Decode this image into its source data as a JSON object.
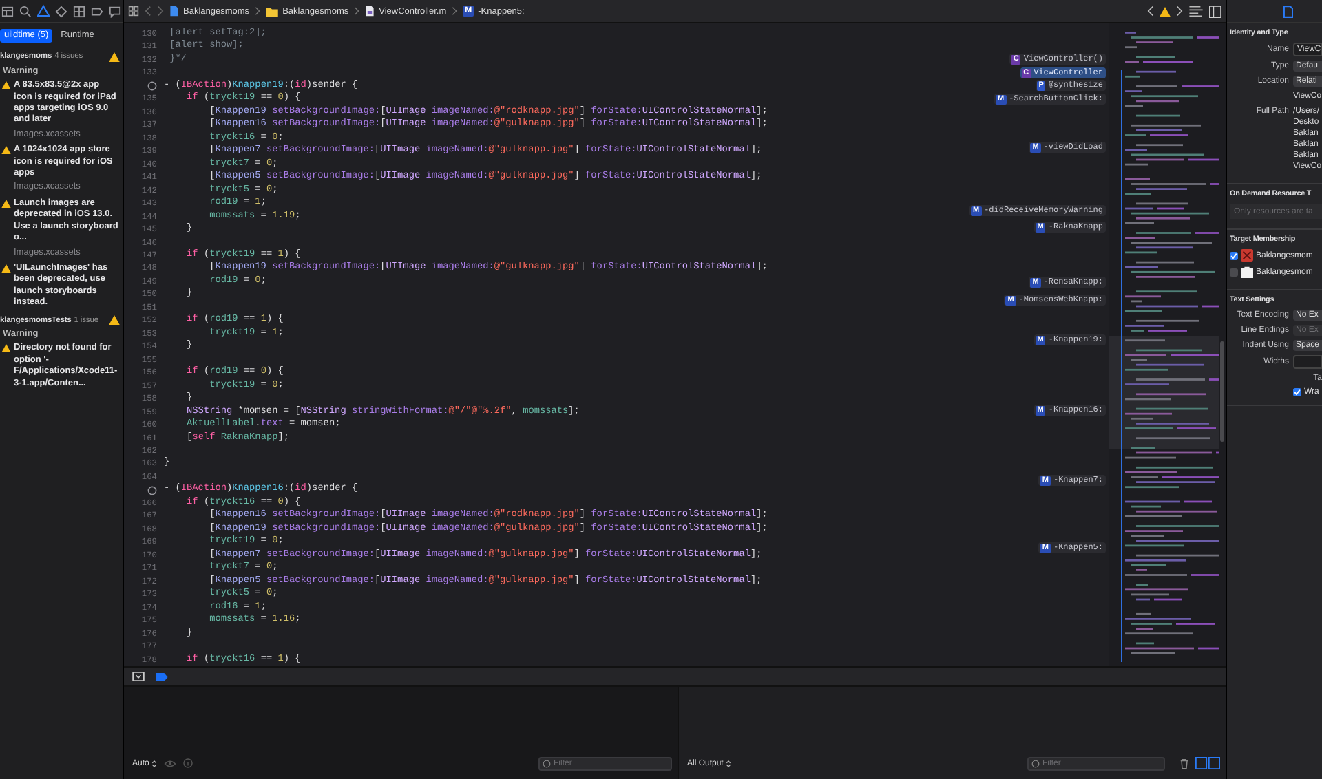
{
  "navigator": {
    "icons": [
      {
        "kind": "hierarchy",
        "selected": false
      },
      {
        "kind": "search",
        "selected": false
      },
      {
        "kind": "warning",
        "selected": true
      },
      {
        "kind": "diamond",
        "selected": false
      },
      {
        "kind": "grid",
        "selected": false
      },
      {
        "kind": "tag",
        "selected": false
      },
      {
        "kind": "bubble",
        "selected": false
      }
    ],
    "scopes": [
      {
        "label": "uildtime (5)",
        "selected": true
      },
      {
        "label": "Runtime",
        "selected": false
      }
    ],
    "groups": [
      {
        "name": "klangesmoms",
        "count": "4 issues",
        "section": "Warning",
        "issues": [
          {
            "message": "A 83.5x83.5@2x app icon is required for iPad apps targeting iOS 9.0 and later",
            "source": "Images.xcassets"
          },
          {
            "message": "A 1024x1024 app store icon is required for iOS apps",
            "source": "Images.xcassets"
          },
          {
            "message": "Launch images are deprecated in iOS 13.0. Use a launch storyboard o...",
            "source": "Images.xcassets"
          },
          {
            "message": "'UILaunchImages' has been deprecated, use launch storyboards instead."
          }
        ]
      },
      {
        "name": "klangesmomsTests",
        "count": "1 issue",
        "section": "Warning",
        "issues": [
          {
            "message": "Directory not found for option '-F/Applications/Xcode11-3-1.app/Conten..."
          }
        ]
      }
    ]
  },
  "editor": {
    "jump_bar": [
      {
        "kind": "project",
        "label": "Baklangesmoms"
      },
      {
        "kind": "folder",
        "label": "Baklangesmoms"
      },
      {
        "kind": "mfile",
        "label": "ViewController.m"
      },
      {
        "kind": "method",
        "badge": "M",
        "label": "-Knappen5:"
      }
    ],
    "lines": [
      {
        "number": "130",
        "outlet": false,
        "tokens": [
          {
            "kind": "comment",
            "text": " [alert setTag:2];"
          }
        ]
      },
      {
        "number": "131",
        "outlet": false,
        "tokens": [
          {
            "kind": "comment",
            "text": " [alert show];"
          }
        ]
      },
      {
        "number": "132",
        "outlet": false,
        "tokens": [
          {
            "kind": "comment",
            "text": " }*/"
          }
        ]
      },
      {
        "number": "133",
        "outlet": false
      },
      {
        "outlet": true,
        "tokens": [
          {
            "kind": "plain",
            "text": "- ("
          },
          {
            "kind": "kw",
            "text": "IBAction"
          },
          {
            "kind": "plain",
            "text": ")"
          },
          {
            "kind": "func",
            "text": "Knappen19"
          },
          {
            "kind": "plain",
            "text": ":("
          },
          {
            "kind": "kw",
            "text": "id"
          },
          {
            "kind": "plain",
            "text": ")sender {"
          }
        ]
      },
      {
        "number": "135",
        "outlet": false,
        "tokens": [
          {
            "kind": "kw",
            "text": "    if"
          },
          {
            "kind": "plain",
            "text": " ("
          },
          {
            "kind": "var",
            "text": "tryckt19"
          },
          {
            "kind": "plain",
            "text": " == "
          },
          {
            "kind": "num",
            "text": "0"
          },
          {
            "kind": "plain",
            "text": ") {"
          }
        ]
      },
      {
        "number": "136",
        "outlet": false,
        "tokens": [
          {
            "kind": "plain",
            "text": "        ["
          },
          {
            "kind": "ivar",
            "text": "Knappen19"
          },
          {
            "kind": "method",
            "text": " setBackgroundImage:"
          },
          {
            "kind": "plain",
            "text": "["
          },
          {
            "kind": "type",
            "text": "UIImage"
          },
          {
            "kind": "method",
            "text": " imageNamed:"
          },
          {
            "kind": "str",
            "text": "@\"rodknapp.jpg\""
          },
          {
            "kind": "plain",
            "text": "] "
          },
          {
            "kind": "method",
            "text": "forState:"
          },
          {
            "kind": "type",
            "text": "UIControlStateNormal"
          },
          {
            "kind": "plain",
            "text": "];"
          }
        ]
      },
      {
        "number": "137",
        "outlet": false,
        "tokens": [
          {
            "kind": "plain",
            "text": "        ["
          },
          {
            "kind": "ivar",
            "text": "Knappen16"
          },
          {
            "kind": "method",
            "text": " setBackgroundImage:"
          },
          {
            "kind": "plain",
            "text": "["
          },
          {
            "kind": "type",
            "text": "UIImage"
          },
          {
            "kind": "method",
            "text": " imageNamed:"
          },
          {
            "kind": "str",
            "text": "@\"gulknapp.jpg\""
          },
          {
            "kind": "plain",
            "text": "] "
          },
          {
            "kind": "method",
            "text": "forState:"
          },
          {
            "kind": "type",
            "text": "UIControlStateNormal"
          },
          {
            "kind": "plain",
            "text": "];"
          }
        ]
      },
      {
        "number": "138",
        "outlet": false,
        "tokens": [
          {
            "kind": "var",
            "text": "        tryckt16"
          },
          {
            "kind": "plain",
            "text": " = "
          },
          {
            "kind": "num",
            "text": "0"
          },
          {
            "kind": "plain",
            "text": ";"
          }
        ]
      },
      {
        "number": "139",
        "outlet": false,
        "tokens": [
          {
            "kind": "plain",
            "text": "        ["
          },
          {
            "kind": "ivar",
            "text": "Knappen7"
          },
          {
            "kind": "method",
            "text": " setBackgroundImage:"
          },
          {
            "kind": "plain",
            "text": "["
          },
          {
            "kind": "type",
            "text": "UIImage"
          },
          {
            "kind": "method",
            "text": " imageNamed:"
          },
          {
            "kind": "str",
            "text": "@\"gulknapp.jpg\""
          },
          {
            "kind": "plain",
            "text": "] "
          },
          {
            "kind": "method",
            "text": "forState:"
          },
          {
            "kind": "type",
            "text": "UIControlStateNormal"
          },
          {
            "kind": "plain",
            "text": "];"
          }
        ]
      },
      {
        "number": "140",
        "outlet": false,
        "tokens": [
          {
            "kind": "var",
            "text": "        tryckt7"
          },
          {
            "kind": "plain",
            "text": " = "
          },
          {
            "kind": "num",
            "text": "0"
          },
          {
            "kind": "plain",
            "text": ";"
          }
        ]
      },
      {
        "number": "141",
        "outlet": false,
        "tokens": [
          {
            "kind": "plain",
            "text": "        ["
          },
          {
            "kind": "ivar",
            "text": "Knappen5"
          },
          {
            "kind": "method",
            "text": " setBackgroundImage:"
          },
          {
            "kind": "plain",
            "text": "["
          },
          {
            "kind": "type",
            "text": "UIImage"
          },
          {
            "kind": "method",
            "text": " imageNamed:"
          },
          {
            "kind": "str",
            "text": "@\"gulknapp.jpg\""
          },
          {
            "kind": "plain",
            "text": "] "
          },
          {
            "kind": "method",
            "text": "forState:"
          },
          {
            "kind": "type",
            "text": "UIControlStateNormal"
          },
          {
            "kind": "plain",
            "text": "];"
          }
        ]
      },
      {
        "number": "142",
        "outlet": false,
        "tokens": [
          {
            "kind": "var",
            "text": "        tryckt5"
          },
          {
            "kind": "plain",
            "text": " = "
          },
          {
            "kind": "num",
            "text": "0"
          },
          {
            "kind": "plain",
            "text": ";"
          }
        ]
      },
      {
        "number": "143",
        "outlet": false,
        "tokens": [
          {
            "kind": "var",
            "text": "        rod19"
          },
          {
            "kind": "plain",
            "text": " = "
          },
          {
            "kind": "num",
            "text": "1"
          },
          {
            "kind": "plain",
            "text": ";"
          }
        ]
      },
      {
        "number": "144",
        "outlet": false,
        "tokens": [
          {
            "kind": "var",
            "text": "        momssats"
          },
          {
            "kind": "plain",
            "text": " = "
          },
          {
            "kind": "num",
            "text": "1.19"
          },
          {
            "kind": "plain",
            "text": ";"
          }
        ]
      },
      {
        "number": "145",
        "outlet": false,
        "tokens": [
          {
            "kind": "plain",
            "text": "    }"
          }
        ]
      },
      {
        "number": "146",
        "outlet": false
      },
      {
        "number": "147",
        "outlet": false,
        "tokens": [
          {
            "kind": "kw",
            "text": "    if"
          },
          {
            "kind": "plain",
            "text": " ("
          },
          {
            "kind": "var",
            "text": "tryckt19"
          },
          {
            "kind": "plain",
            "text": " == "
          },
          {
            "kind": "num",
            "text": "1"
          },
          {
            "kind": "plain",
            "text": ") {"
          }
        ]
      },
      {
        "number": "148",
        "outlet": false,
        "tokens": [
          {
            "kind": "plain",
            "text": "        ["
          },
          {
            "kind": "ivar",
            "text": "Knappen19"
          },
          {
            "kind": "method",
            "text": " setBackgroundImage:"
          },
          {
            "kind": "plain",
            "text": "["
          },
          {
            "kind": "type",
            "text": "UIImage"
          },
          {
            "kind": "method",
            "text": " imageNamed:"
          },
          {
            "kind": "str",
            "text": "@\"gulknapp.jpg\""
          },
          {
            "kind": "plain",
            "text": "] "
          },
          {
            "kind": "method",
            "text": "forState:"
          },
          {
            "kind": "type",
            "text": "UIControlStateNormal"
          },
          {
            "kind": "plain",
            "text": "];"
          }
        ]
      },
      {
        "number": "149",
        "outlet": false,
        "tokens": [
          {
            "kind": "var",
            "text": "        rod19"
          },
          {
            "kind": "plain",
            "text": " = "
          },
          {
            "kind": "num",
            "text": "0"
          },
          {
            "kind": "plain",
            "text": ";"
          }
        ]
      },
      {
        "number": "150",
        "outlet": false,
        "tokens": [
          {
            "kind": "plain",
            "text": "    }"
          }
        ]
      },
      {
        "number": "151",
        "outlet": false
      },
      {
        "number": "152",
        "outlet": false,
        "tokens": [
          {
            "kind": "kw",
            "text": "    if"
          },
          {
            "kind": "plain",
            "text": " ("
          },
          {
            "kind": "var",
            "text": "rod19"
          },
          {
            "kind": "plain",
            "text": " == "
          },
          {
            "kind": "num",
            "text": "1"
          },
          {
            "kind": "plain",
            "text": ") {"
          }
        ]
      },
      {
        "number": "153",
        "outlet": false,
        "tokens": [
          {
            "kind": "var",
            "text": "        tryckt19"
          },
          {
            "kind": "plain",
            "text": " = "
          },
          {
            "kind": "num",
            "text": "1"
          },
          {
            "kind": "plain",
            "text": ";"
          }
        ]
      },
      {
        "number": "154",
        "outlet": false,
        "tokens": [
          {
            "kind": "plain",
            "text": "    }"
          }
        ]
      },
      {
        "number": "155",
        "outlet": false
      },
      {
        "number": "156",
        "outlet": false,
        "tokens": [
          {
            "kind": "kw",
            "text": "    if"
          },
          {
            "kind": "plain",
            "text": " ("
          },
          {
            "kind": "var",
            "text": "rod19"
          },
          {
            "kind": "plain",
            "text": " == "
          },
          {
            "kind": "num",
            "text": "0"
          },
          {
            "kind": "plain",
            "text": ") {"
          }
        ]
      },
      {
        "number": "157",
        "outlet": false,
        "tokens": [
          {
            "kind": "var",
            "text": "        tryckt19"
          },
          {
            "kind": "plain",
            "text": " = "
          },
          {
            "kind": "num",
            "text": "0"
          },
          {
            "kind": "plain",
            "text": ";"
          }
        ]
      },
      {
        "number": "158",
        "outlet": false,
        "tokens": [
          {
            "kind": "plain",
            "text": "    }"
          }
        ]
      },
      {
        "number": "159",
        "outlet": false,
        "tokens": [
          {
            "kind": "type",
            "text": "    NSString"
          },
          {
            "kind": "plain",
            "text": " *momsen = ["
          },
          {
            "kind": "type",
            "text": "NSString"
          },
          {
            "kind": "method",
            "text": " stringWithFormat:"
          },
          {
            "kind": "str",
            "text": "@\"/\"@\"%.2f\""
          },
          {
            "kind": "plain",
            "text": ", "
          },
          {
            "kind": "var",
            "text": "momssats"
          },
          {
            "kind": "plain",
            "text": "];"
          }
        ]
      },
      {
        "number": "160",
        "outlet": false,
        "tokens": [
          {
            "kind": "var",
            "text": "    AktuellLabel"
          },
          {
            "kind": "plain",
            "text": "."
          },
          {
            "kind": "method",
            "text": "text"
          },
          {
            "kind": "plain",
            "text": " = momsen;"
          }
        ]
      },
      {
        "number": "161",
        "outlet": false,
        "tokens": [
          {
            "kind": "plain",
            "text": "    ["
          },
          {
            "kind": "kw",
            "text": "self"
          },
          {
            "kind": "var",
            "text": " RaknaKnapp"
          },
          {
            "kind": "plain",
            "text": "];"
          }
        ]
      },
      {
        "number": "162",
        "outlet": false
      },
      {
        "number": "163",
        "outlet": false,
        "tokens": [
          {
            "kind": "plain",
            "text": "}"
          }
        ]
      },
      {
        "number": "164",
        "outlet": false
      },
      {
        "outlet": true,
        "tokens": [
          {
            "kind": "plain",
            "text": "- ("
          },
          {
            "kind": "kw",
            "text": "IBAction"
          },
          {
            "kind": "plain",
            "text": ")"
          },
          {
            "kind": "func",
            "text": "Knappen16"
          },
          {
            "kind": "plain",
            "text": ":("
          },
          {
            "kind": "kw",
            "text": "id"
          },
          {
            "kind": "plain",
            "text": ")sender {"
          }
        ]
      },
      {
        "number": "166",
        "outlet": false,
        "tokens": [
          {
            "kind": "kw",
            "text": "    if"
          },
          {
            "kind": "plain",
            "text": " ("
          },
          {
            "kind": "var",
            "text": "tryckt16"
          },
          {
            "kind": "plain",
            "text": " == "
          },
          {
            "kind": "num",
            "text": "0"
          },
          {
            "kind": "plain",
            "text": ") {"
          }
        ]
      },
      {
        "number": "167",
        "outlet": false,
        "tokens": [
          {
            "kind": "plain",
            "text": "        ["
          },
          {
            "kind": "ivar",
            "text": "Knappen16"
          },
          {
            "kind": "method",
            "text": " setBackgroundImage:"
          },
          {
            "kind": "plain",
            "text": "["
          },
          {
            "kind": "type",
            "text": "UIImage"
          },
          {
            "kind": "method",
            "text": " imageNamed:"
          },
          {
            "kind": "str",
            "text": "@\"rodknapp.jpg\""
          },
          {
            "kind": "plain",
            "text": "] "
          },
          {
            "kind": "method",
            "text": "forState:"
          },
          {
            "kind": "type",
            "text": "UIControlStateNormal"
          },
          {
            "kind": "plain",
            "text": "];"
          }
        ]
      },
      {
        "number": "168",
        "outlet": false,
        "tokens": [
          {
            "kind": "plain",
            "text": "        ["
          },
          {
            "kind": "ivar",
            "text": "Knappen19"
          },
          {
            "kind": "method",
            "text": " setBackgroundImage:"
          },
          {
            "kind": "plain",
            "text": "["
          },
          {
            "kind": "type",
            "text": "UIImage"
          },
          {
            "kind": "method",
            "text": " imageNamed:"
          },
          {
            "kind": "str",
            "text": "@\"gulknapp.jpg\""
          },
          {
            "kind": "plain",
            "text": "] "
          },
          {
            "kind": "method",
            "text": "forState:"
          },
          {
            "kind": "type",
            "text": "UIControlStateNormal"
          },
          {
            "kind": "plain",
            "text": "];"
          }
        ]
      },
      {
        "number": "169",
        "outlet": false,
        "tokens": [
          {
            "kind": "var",
            "text": "        tryckt19"
          },
          {
            "kind": "plain",
            "text": " = "
          },
          {
            "kind": "num",
            "text": "0"
          },
          {
            "kind": "plain",
            "text": ";"
          }
        ]
      },
      {
        "number": "170",
        "outlet": false,
        "tokens": [
          {
            "kind": "plain",
            "text": "        ["
          },
          {
            "kind": "ivar",
            "text": "Knappen7"
          },
          {
            "kind": "method",
            "text": " setBackgroundImage:"
          },
          {
            "kind": "plain",
            "text": "["
          },
          {
            "kind": "type",
            "text": "UIImage"
          },
          {
            "kind": "method",
            "text": " imageNamed:"
          },
          {
            "kind": "str",
            "text": "@\"gulknapp.jpg\""
          },
          {
            "kind": "plain",
            "text": "] "
          },
          {
            "kind": "method",
            "text": "forState:"
          },
          {
            "kind": "type",
            "text": "UIControlStateNormal"
          },
          {
            "kind": "plain",
            "text": "];"
          }
        ]
      },
      {
        "number": "171",
        "outlet": false,
        "tokens": [
          {
            "kind": "var",
            "text": "        tryckt7"
          },
          {
            "kind": "plain",
            "text": " = "
          },
          {
            "kind": "num",
            "text": "0"
          },
          {
            "kind": "plain",
            "text": ";"
          }
        ]
      },
      {
        "number": "172",
        "outlet": false,
        "tokens": [
          {
            "kind": "plain",
            "text": "        ["
          },
          {
            "kind": "ivar",
            "text": "Knappen5"
          },
          {
            "kind": "method",
            "text": " setBackgroundImage:"
          },
          {
            "kind": "plain",
            "text": "["
          },
          {
            "kind": "type",
            "text": "UIImage"
          },
          {
            "kind": "method",
            "text": " imageNamed:"
          },
          {
            "kind": "str",
            "text": "@\"gulknapp.jpg\""
          },
          {
            "kind": "plain",
            "text": "] "
          },
          {
            "kind": "method",
            "text": "forState:"
          },
          {
            "kind": "type",
            "text": "UIControlStateNormal"
          },
          {
            "kind": "plain",
            "text": "];"
          }
        ]
      },
      {
        "number": "173",
        "outlet": false,
        "tokens": [
          {
            "kind": "var",
            "text": "        tryckt5"
          },
          {
            "kind": "plain",
            "text": " = "
          },
          {
            "kind": "num",
            "text": "0"
          },
          {
            "kind": "plain",
            "text": ";"
          }
        ]
      },
      {
        "number": "174",
        "outlet": false,
        "tokens": [
          {
            "kind": "var",
            "text": "        rod16"
          },
          {
            "kind": "plain",
            "text": " = "
          },
          {
            "kind": "num",
            "text": "1"
          },
          {
            "kind": "plain",
            "text": ";"
          }
        ]
      },
      {
        "number": "175",
        "outlet": false,
        "tokens": [
          {
            "kind": "var",
            "text": "        momssats"
          },
          {
            "kind": "plain",
            "text": " = "
          },
          {
            "kind": "num",
            "text": "1.16"
          },
          {
            "kind": "plain",
            "text": ";"
          }
        ]
      },
      {
        "number": "176",
        "outlet": false,
        "tokens": [
          {
            "kind": "plain",
            "text": "    }"
          }
        ]
      },
      {
        "number": "177",
        "outlet": false
      },
      {
        "number": "178",
        "outlet": false,
        "tokens": [
          {
            "kind": "kw",
            "text": "    if"
          },
          {
            "kind": "plain",
            "text": " ("
          },
          {
            "kind": "var",
            "text": "tryckt16"
          },
          {
            "kind": "plain",
            "text": " == "
          },
          {
            "kind": "num",
            "text": "1"
          },
          {
            "kind": "plain",
            "text": ") {"
          }
        ]
      }
    ],
    "symbol_tags": [
      {
        "kind": "class",
        "badge": "C",
        "label": "ViewController()",
        "selected": false
      },
      {
        "kind": "class",
        "badge": "C",
        "label": "ViewController",
        "selected": true
      },
      {
        "kind": "property",
        "badge": "P",
        "label": "@synthesize",
        "selected": false
      },
      {
        "kind": "method",
        "badge": "M",
        "label": "-SearchButtonClick:",
        "selected": false
      },
      {
        "kind": "method",
        "badge": "M",
        "label": "-viewDidLoad",
        "selected": false
      },
      {
        "kind": "method",
        "badge": "M",
        "label": "-didReceiveMemoryWarning",
        "selected": false
      },
      {
        "kind": "method",
        "badge": "M",
        "label": "-RaknaKnapp",
        "selected": false
      },
      {
        "kind": "method",
        "badge": "M",
        "label": "-RensaKnapp:",
        "selected": false
      },
      {
        "kind": "method",
        "badge": "M",
        "label": "-MomsensWebKnapp:",
        "selected": false
      },
      {
        "kind": "method",
        "badge": "M",
        "label": "-Knappen19:",
        "selected": false
      },
      {
        "kind": "method",
        "badge": "M",
        "label": "-Knappen16:",
        "selected": false
      },
      {
        "kind": "method",
        "badge": "M",
        "label": "-Knappen7:",
        "selected": false
      },
      {
        "kind": "method",
        "badge": "M",
        "label": "-Knappen5:",
        "selected": false
      }
    ]
  },
  "debug": {
    "variables": {
      "scope": "Auto",
      "filter_placeholder": "Filter"
    },
    "console": {
      "output": "All Output",
      "filter_placeholder": "Filter"
    }
  },
  "inspector": {
    "identity": {
      "title": "Identity and Type",
      "rows": [
        {
          "kind": "field",
          "label": "Name",
          "value": "ViewC"
        },
        {
          "kind": "popup",
          "label": "Type",
          "value": "Defau"
        },
        {
          "kind": "popup",
          "label": "Location",
          "value": "Relati"
        }
      ],
      "location_path": "ViewCo",
      "full_path_label": "Full Path",
      "full_path_lines": [
        "/Users/",
        "Deskto",
        "Baklan",
        "Baklan",
        "Baklan",
        "ViewCo"
      ]
    },
    "on_demand": {
      "title": "On Demand Resource T",
      "placeholder": "Only resources are ta"
    },
    "membership": {
      "title": "Target Membership",
      "targets": [
        {
          "kind": "app",
          "name": "Baklangesmom",
          "checked": true
        },
        {
          "kind": "tests",
          "name": "Baklangesmom",
          "checked": false
        }
      ]
    },
    "text_settings": {
      "title": "Text Settings",
      "rows": [
        {
          "kind": "popup",
          "label": "Text Encoding",
          "value": "No Ex",
          "disabled": false
        },
        {
          "kind": "popup",
          "label": "Line Endings",
          "value": "No Ex",
          "disabled": true
        },
        {
          "kind": "popup",
          "label": "Indent Using",
          "value": "Space",
          "disabled": false
        },
        {
          "kind": "field",
          "label": "Widths",
          "disabled": false
        }
      ],
      "tab_label": "Ta",
      "wrap": {
        "label": "Wra",
        "checked": true
      }
    }
  }
}
